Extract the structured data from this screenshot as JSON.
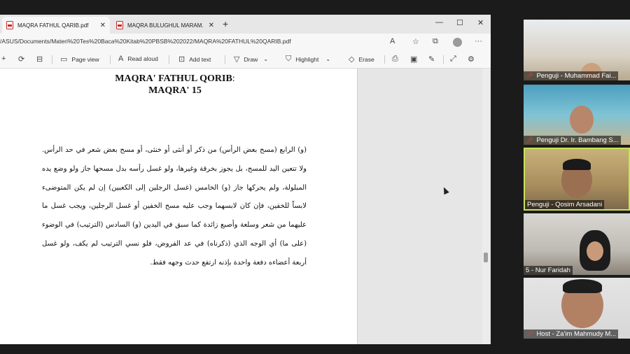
{
  "browser": {
    "tabs": [
      {
        "label": "MAQRA FATHUL QARIB.pdf",
        "active": true
      },
      {
        "label": "MAQRA BULUGHUL MARAM.pdf",
        "active": false
      }
    ],
    "url": "/ASUS/Documents/Materi%20Tes%20Baca%20Kitab%20PBSB%202022/MAQRA%20FATHUL%20QARIB.pdf"
  },
  "pdf_toolbar": {
    "page_view": "Page view",
    "read_aloud": "Read aloud",
    "add_text": "Add text",
    "draw": "Draw",
    "highlight": "Highlight",
    "erase": "Erase"
  },
  "document": {
    "title": "MAQRA' FATHUL QORIB",
    "title_suffix": ":",
    "subtitle": "MAQRA' 15",
    "body": "(و) الرابع (مسح بعض الرأس) من ذكر أو أنثى أو خنثى، أو مسح بعض شعر في حد الرأس. ولا تتعين اليد للمسح، بل يجوز بخرقة وغيرها، ولو غسل رأسه بدل مسحها جاز ولو وضع يده المبلولة، ولم يحركها جاز (و) الخامس (غسل الرجلين إلى الكعبين) إن لم يكن المتوضىء لابساً للخفين، فإن كان لابسهما وجب عليه مسح الخفين أو غسل الرجلين، ويجب غسل ما عليهما من شعر وسلعة وأصبع زائدة كما سبق في اليدين (و) السادس (الترتيب) في الوضوء (على ما) أي الوجه الذي (ذكرناه) في عد الفروض، فلو نسي الترتيب لم يكف، ولو غسل أربعة أعضاءه دفعة واحدة بإذنه ارتفع حدث وجهه فقط."
  },
  "participants": [
    {
      "name": "Penguji - Muhammad Fai...",
      "muted": true
    },
    {
      "name": "Penguji Dr. Ir. Bambang S...",
      "muted": true
    },
    {
      "name": "Penguji - Qosim Arsadani",
      "muted": false,
      "speaking": true
    },
    {
      "name": "5 - Nur Faridah",
      "muted": false
    },
    {
      "name": "Host - Za'im Mahmudy M...",
      "muted": true
    }
  ],
  "colors": {
    "mic_muted": "#e43b3b",
    "active_speaker": "#c8e35a",
    "pdf_icon": "#c62828"
  }
}
